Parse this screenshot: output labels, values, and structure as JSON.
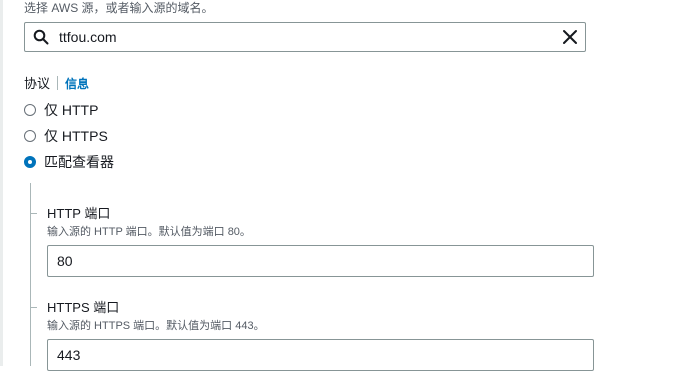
{
  "origin": {
    "description": "选择 AWS 源，或者输入源的域名。",
    "search_value": "ttfou.com",
    "search_icon": "search-icon",
    "clear_icon": "close-icon"
  },
  "protocol": {
    "label": "协议",
    "info_link": "信息",
    "options": [
      {
        "label": "仅 HTTP",
        "selected": false
      },
      {
        "label": "仅 HTTPS",
        "selected": false
      },
      {
        "label": "匹配查看器",
        "selected": true
      }
    ]
  },
  "http_port": {
    "label": "HTTP 端口",
    "description": "输入源的 HTTP 端口。默认值为端口 80。",
    "value": "80"
  },
  "https_port": {
    "label": "HTTPS 端口",
    "description": "输入源的 HTTPS 端口。默认值为端口 443。",
    "value": "443"
  },
  "colors": {
    "accent": "#0073bb",
    "text": "#16191f",
    "muted": "#545b64",
    "border": "#879596"
  }
}
